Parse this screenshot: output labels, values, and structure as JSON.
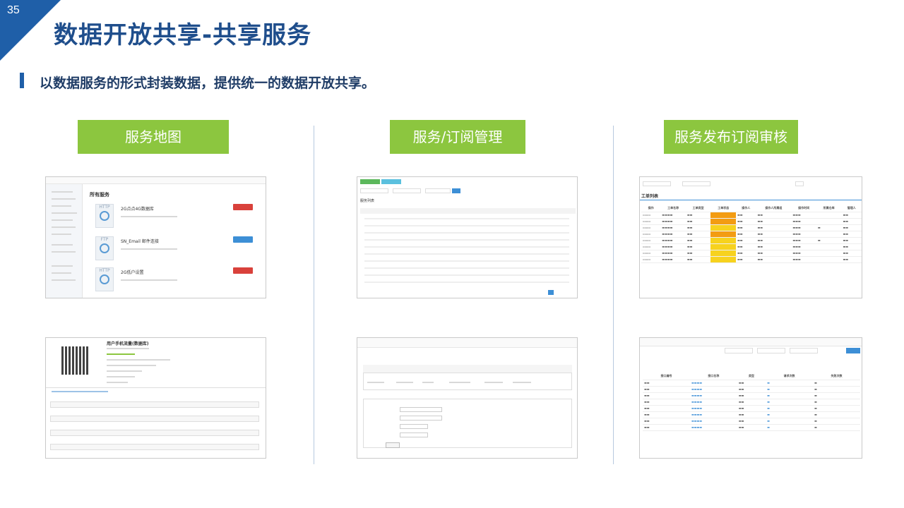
{
  "slide": {
    "page_number": "35",
    "title": "数据开放共享-共享服务",
    "subtitle": "以数据服务的形式封装数据，提供统一的数据开放共享。"
  },
  "sections": [
    {
      "label": "服务地图"
    },
    {
      "label": "服务/订阅管理"
    },
    {
      "label": "服务发布订阅审核"
    }
  ],
  "shots": {
    "service_map": {
      "heading": "所有服务",
      "items": [
        {
          "icon": "HTTP",
          "name": "2G点点4G数据库"
        },
        {
          "icon": "FTP",
          "name": "SN_Email 邮件连接"
        },
        {
          "icon": "HTTP",
          "name": "2G低户设置"
        }
      ]
    },
    "service_detail": {
      "name": "用户手机流量(数据库)"
    },
    "subscription_list": {
      "tab_label": "服务列表"
    },
    "review_list": {
      "heading": "工单列表",
      "columns": [
        "操作",
        "工单名称",
        "工单类型",
        "工单状态",
        "操作人",
        "操作人所属组",
        "操作时间",
        "所属仓库",
        "管理人"
      ]
    },
    "interface_list": {
      "columns": [
        "接口编号",
        "接口名称",
        "类型",
        "请求次数",
        "失败次数"
      ]
    }
  },
  "colors": {
    "brand_blue": "#1f5fa8",
    "title_blue": "#1f4e8c",
    "label_green": "#8cc63f"
  }
}
